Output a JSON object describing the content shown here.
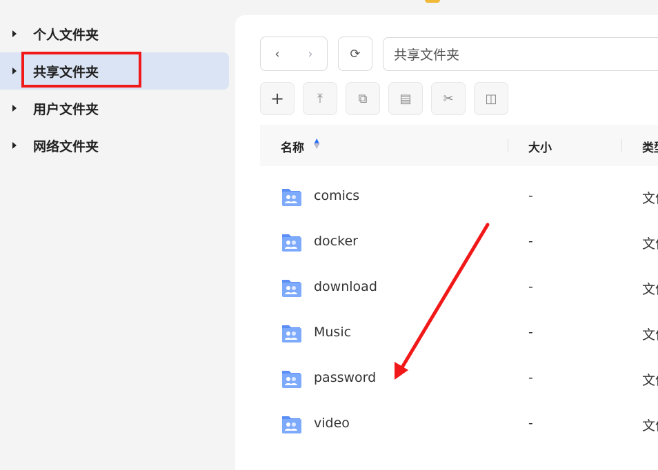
{
  "sidebar": {
    "items": [
      {
        "label": "个人文件夹"
      },
      {
        "label": "共享文件夹",
        "selected": true
      },
      {
        "label": "用户文件夹"
      },
      {
        "label": "网络文件夹"
      }
    ]
  },
  "toolbar": {
    "path": "共享文件夹",
    "icons": [
      "back-icon",
      "forward-icon",
      "refresh-icon",
      "plus-icon",
      "upload-icon",
      "copy-icon",
      "paste-icon",
      "cut-icon",
      "rename-icon"
    ]
  },
  "table": {
    "headers": {
      "name": "名称",
      "size": "大小",
      "type": "类型"
    },
    "rows": [
      {
        "name": "comics",
        "size": "-",
        "type": "文件夹",
        "icon": "shared-folder-icon"
      },
      {
        "name": "docker",
        "size": "-",
        "type": "文件夹",
        "icon": "docker-folder-icon"
      },
      {
        "name": "download",
        "size": "-",
        "type": "文件夹",
        "icon": "shared-folder-icon"
      },
      {
        "name": "Music",
        "size": "-",
        "type": "文件夹",
        "icon": "music-folder-icon"
      },
      {
        "name": "password",
        "size": "-",
        "type": "文件夹",
        "icon": "shared-folder-icon"
      },
      {
        "name": "video",
        "size": "-",
        "type": "文件夹",
        "icon": "shared-folder-icon"
      }
    ]
  },
  "colors": {
    "folder": "#6c9ef8",
    "annotation": "#f01818",
    "selected": "#dbe4f4"
  }
}
